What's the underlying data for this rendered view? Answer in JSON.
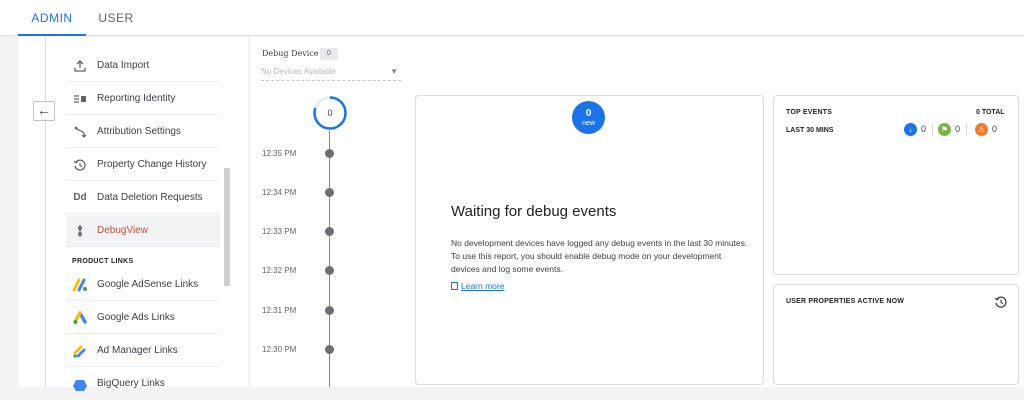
{
  "tabs": [
    {
      "label": "ADMIN",
      "active": true
    },
    {
      "label": "USER",
      "active": false
    }
  ],
  "sidebar": {
    "back_icon": "arrow-left-icon",
    "items": [
      {
        "label": "Data Import",
        "icon": "upload-icon"
      },
      {
        "label": "Reporting Identity",
        "icon": "reporting-identity-icon"
      },
      {
        "label": "Attribution Settings",
        "icon": "attribution-icon"
      },
      {
        "label": "Property Change History",
        "icon": "history-icon"
      },
      {
        "label": "Data Deletion Requests",
        "icon": "data-deletion-icon"
      },
      {
        "label": "DebugView",
        "icon": "debug-icon",
        "active": true
      }
    ],
    "section_title": "PRODUCT LINKS",
    "product_links": [
      {
        "label": "Google AdSense Links",
        "icon": "adsense-logo-icon"
      },
      {
        "label": "Google Ads Links",
        "icon": "google-ads-logo-icon"
      },
      {
        "label": "Ad Manager Links",
        "icon": "ad-manager-logo-icon"
      },
      {
        "label": "BigQuery Links",
        "icon": "bigquery-logo-icon"
      }
    ]
  },
  "debug_device": {
    "label": "Debug Device",
    "count": "0",
    "placeholder": "No Devices Available"
  },
  "timeline": {
    "counter": "0",
    "times": [
      "12:35 PM",
      "12:34 PM",
      "12:33 PM",
      "12:32 PM",
      "12:31 PM",
      "12:30 PM"
    ]
  },
  "center_card": {
    "badge_count": "0",
    "badge_label": "new",
    "title": "Waiting for debug events",
    "description": "No development devices have logged any debug events in the last 30 minutes. To use this report, you should enable debug mode on your development devices and log some events.",
    "link": "Learn more"
  },
  "top_events": {
    "title": "TOP EVENTS",
    "total": "0 TOTAL",
    "range": "LAST 30 MINS",
    "counters": [
      {
        "value": "0",
        "color": "#1a73e8",
        "icon": "event-icon"
      },
      {
        "value": "0",
        "color": "#7cb342",
        "icon": "flag-icon"
      },
      {
        "value": "0",
        "color": "#f4792a",
        "icon": "error-icon"
      }
    ]
  },
  "user_properties": {
    "title": "USER PROPERTIES ACTIVE NOW",
    "icon": "history-icon"
  },
  "colors": {
    "accent": "#1a73e8",
    "active_item": "#c5503a"
  }
}
